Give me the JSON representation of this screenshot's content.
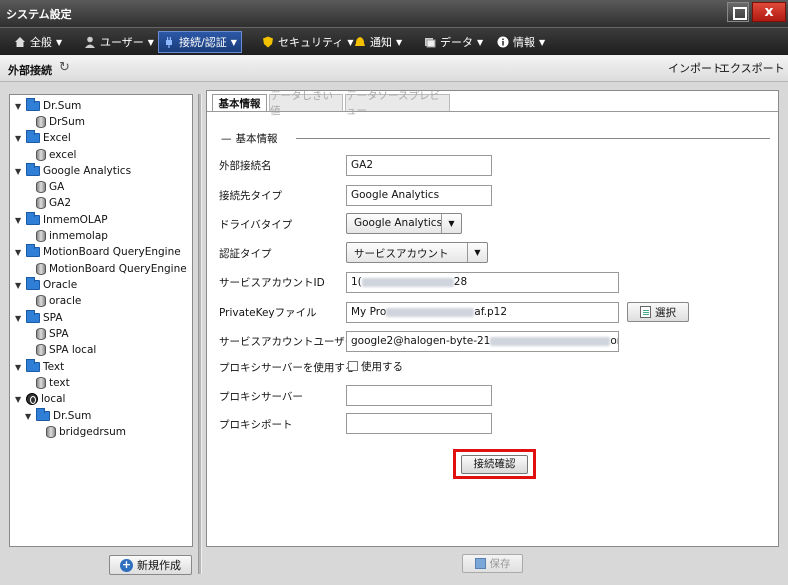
{
  "window": {
    "title": "システム設定",
    "close": "x"
  },
  "menu": [
    {
      "label": "全般",
      "icon": "home-icon",
      "active": false
    },
    {
      "label": "ユーザー",
      "icon": "user-icon",
      "active": false
    },
    {
      "label": "接続/認証",
      "icon": "plug-icon",
      "active": true
    },
    {
      "label": "セキュリティ",
      "icon": "shield-icon",
      "active": false
    },
    {
      "label": "通知",
      "icon": "bell-icon",
      "active": false
    },
    {
      "label": "データ",
      "icon": "data-icon",
      "active": false
    },
    {
      "label": "情報",
      "icon": "info-icon",
      "active": false
    }
  ],
  "header": {
    "title": "外部接続",
    "import": "インポート",
    "export": "エクスポート"
  },
  "tree": [
    {
      "label": "Dr.Sum",
      "type": "folder",
      "level": 0
    },
    {
      "label": "DrSum",
      "type": "db",
      "level": 1
    },
    {
      "label": "Excel",
      "type": "folder",
      "level": 0
    },
    {
      "label": "excel",
      "type": "db",
      "level": 1
    },
    {
      "label": "Google Analytics",
      "type": "folder",
      "level": 0
    },
    {
      "label": "GA",
      "type": "db",
      "level": 1
    },
    {
      "label": "GA2",
      "type": "db",
      "level": 1
    },
    {
      "label": "InmemOLAP",
      "type": "folder",
      "level": 0
    },
    {
      "label": "inmemolap",
      "type": "db",
      "level": 1
    },
    {
      "label": "MotionBoard QueryEngine",
      "type": "folder",
      "level": 0
    },
    {
      "label": "MotionBoard QueryEngine",
      "type": "db",
      "level": 1
    },
    {
      "label": "Oracle",
      "type": "folder",
      "level": 0
    },
    {
      "label": "oracle",
      "type": "db",
      "level": 1
    },
    {
      "label": "SPA",
      "type": "folder",
      "level": 0
    },
    {
      "label": "SPA",
      "type": "db",
      "level": 1
    },
    {
      "label": "SPA local",
      "type": "db",
      "level": 1
    },
    {
      "label": "Text",
      "type": "folder",
      "level": 0
    },
    {
      "label": "text",
      "type": "db",
      "level": 1
    },
    {
      "label": "local",
      "type": "globe",
      "level": 0
    },
    {
      "label": "Dr.Sum",
      "type": "folder",
      "level": 1
    },
    {
      "label": "bridgedrsum",
      "type": "db",
      "level": 2
    }
  ],
  "new_button": "新規作成",
  "tabs": [
    "基本情報",
    "データしきい値",
    "データソースプレビュー"
  ],
  "section_title": "基本情報",
  "form": {
    "name_label": "外部接続名",
    "name_value": "GA2",
    "dest_label": "接続先タイプ",
    "dest_value": "Google Analytics",
    "driver_label": "ドライバタイプ",
    "driver_value": "Google Analytics",
    "auth_label": "認証タイプ",
    "auth_value": "サービスアカウント",
    "sa_id_label": "サービスアカウントID",
    "sa_id_prefix": "1(",
    "sa_id_suffix": "28",
    "key_label": "PrivateKeyファイル",
    "key_prefix": "My Pro",
    "key_suffix": "af.p12",
    "select_button": "選択",
    "sa_user_label": "サービスアカウントユーザー",
    "sa_user_prefix": "google2@halogen-byte-21",
    "sa_user_suffix": "om",
    "proxy_use_label": "プロキシサーバーを使用する",
    "proxy_use_checkbox": "使用する",
    "proxy_server_label": "プロキシサーバー",
    "proxy_server_value": "",
    "proxy_port_label": "プロキシポート",
    "proxy_port_value": ""
  },
  "connect_button": "接続確認",
  "save_button": "保存"
}
